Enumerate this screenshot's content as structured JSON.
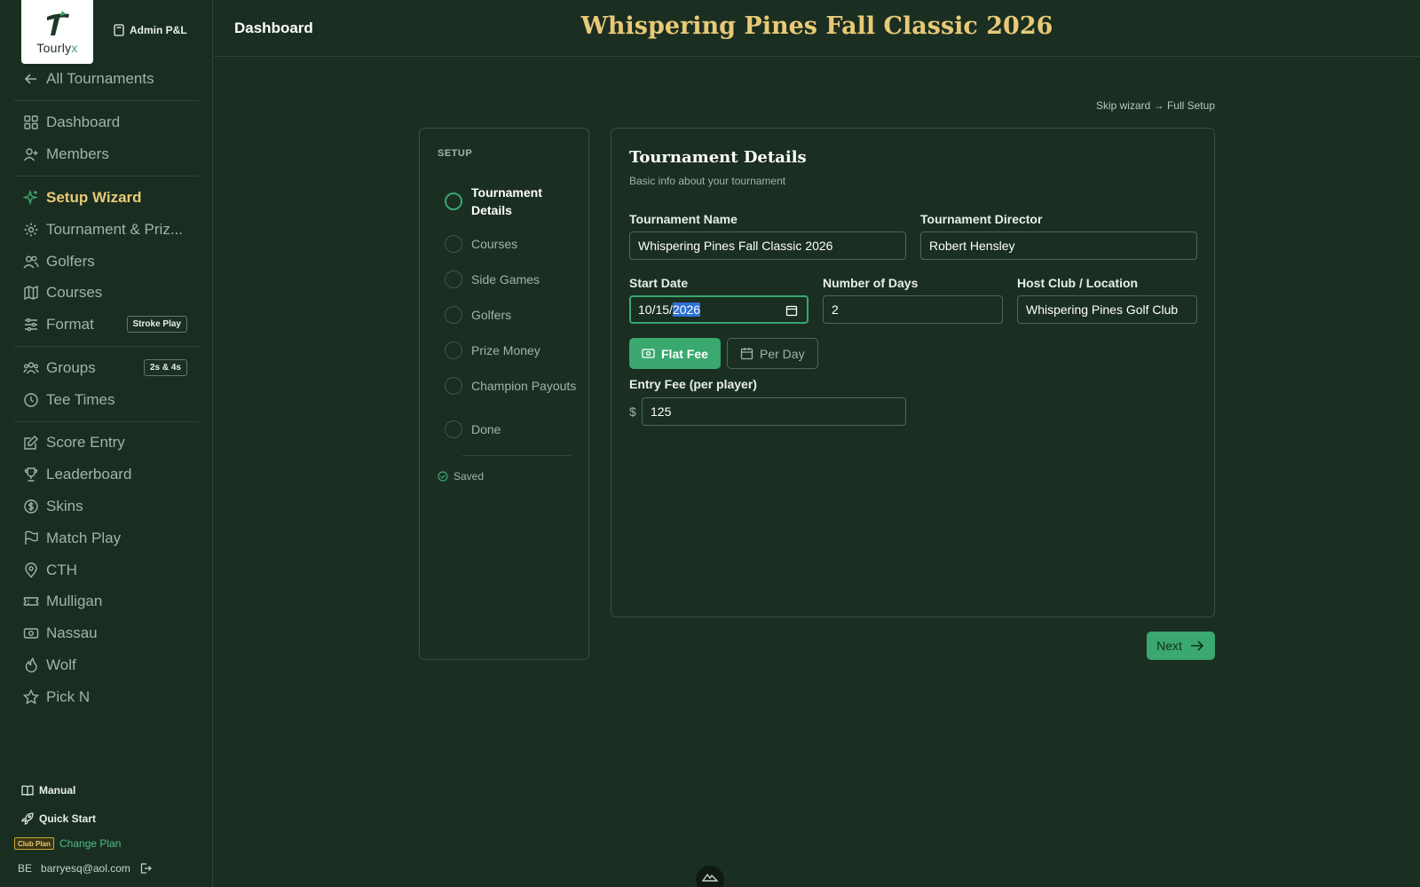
{
  "brand": {
    "logo_text_main": "Tourly",
    "logo_text_accent": "x"
  },
  "sidebar": {
    "admin_label": "Admin P&L",
    "back_label": "All Tournaments",
    "items": [
      {
        "label": "Dashboard",
        "icon": "grid-icon"
      },
      {
        "label": "Members",
        "icon": "user-plus-icon"
      },
      {
        "label": "Setup Wizard",
        "icon": "sparkles-icon",
        "active": true
      },
      {
        "label": "Tournament & Priz...",
        "icon": "gear-icon"
      },
      {
        "label": "Golfers",
        "icon": "users-icon"
      },
      {
        "label": "Courses",
        "icon": "map-icon"
      },
      {
        "label": "Format",
        "icon": "sliders-icon",
        "badge": "Stroke Play"
      },
      {
        "label": "Groups",
        "icon": "group-icon",
        "badge": "2s & 4s"
      },
      {
        "label": "Tee Times",
        "icon": "clock-icon"
      },
      {
        "label": "Score Entry",
        "icon": "edit-icon"
      },
      {
        "label": "Leaderboard",
        "icon": "trophy-icon"
      },
      {
        "label": "Skins",
        "icon": "dollar-icon"
      },
      {
        "label": "Match Play",
        "icon": "flag-icon"
      },
      {
        "label": "CTH",
        "icon": "pin-icon"
      },
      {
        "label": "Mulligan",
        "icon": "ticket-icon"
      },
      {
        "label": "Nassau",
        "icon": "cash-icon"
      },
      {
        "label": "Wolf",
        "icon": "flame-icon"
      },
      {
        "label": "Pick N",
        "icon": "star-icon"
      }
    ],
    "manual_label": "Manual",
    "quick_start_label": "Quick Start",
    "plan_badge": "Club Plan",
    "change_plan_label": "Change Plan",
    "user_initials": "BE",
    "user_email": "barryesq@aol.com"
  },
  "header": {
    "dashboard_label": "Dashboard",
    "title": "Whispering Pines Fall Classic 2026"
  },
  "skip_link": "Skip wizard → Full Setup",
  "stepper": {
    "label": "SETUP",
    "steps": [
      {
        "label": "Tournament Details",
        "current": true
      },
      {
        "label": "Courses"
      },
      {
        "label": "Side Games"
      },
      {
        "label": "Golfers"
      },
      {
        "label": "Prize Money"
      },
      {
        "label": "Champion Payouts"
      },
      {
        "label": "Done"
      }
    ],
    "saved_label": "Saved"
  },
  "form": {
    "title": "Tournament Details",
    "subtitle": "Basic info about your tournament",
    "name_label": "Tournament Name",
    "name_value": "Whispering Pines Fall Classic 2026",
    "director_label": "Tournament Director",
    "director_value": "Robert Hensley",
    "start_label": "Start Date",
    "start_value_prefix": "10/15/",
    "start_value_selected": "2026",
    "days_label": "Number of Days",
    "days_value": "2",
    "host_label": "Host Club / Location",
    "host_value": "Whispering Pines Golf Club",
    "fee_flat_label": "Flat Fee",
    "fee_day_label": "Per Day",
    "entry_label": "Entry Fee (per player)",
    "currency_symbol": "$",
    "entry_value": "125"
  },
  "next_label": "Next",
  "colors": {
    "accent": "#3aa86f",
    "gold": "#e8c975",
    "background": "#1b2e22"
  }
}
